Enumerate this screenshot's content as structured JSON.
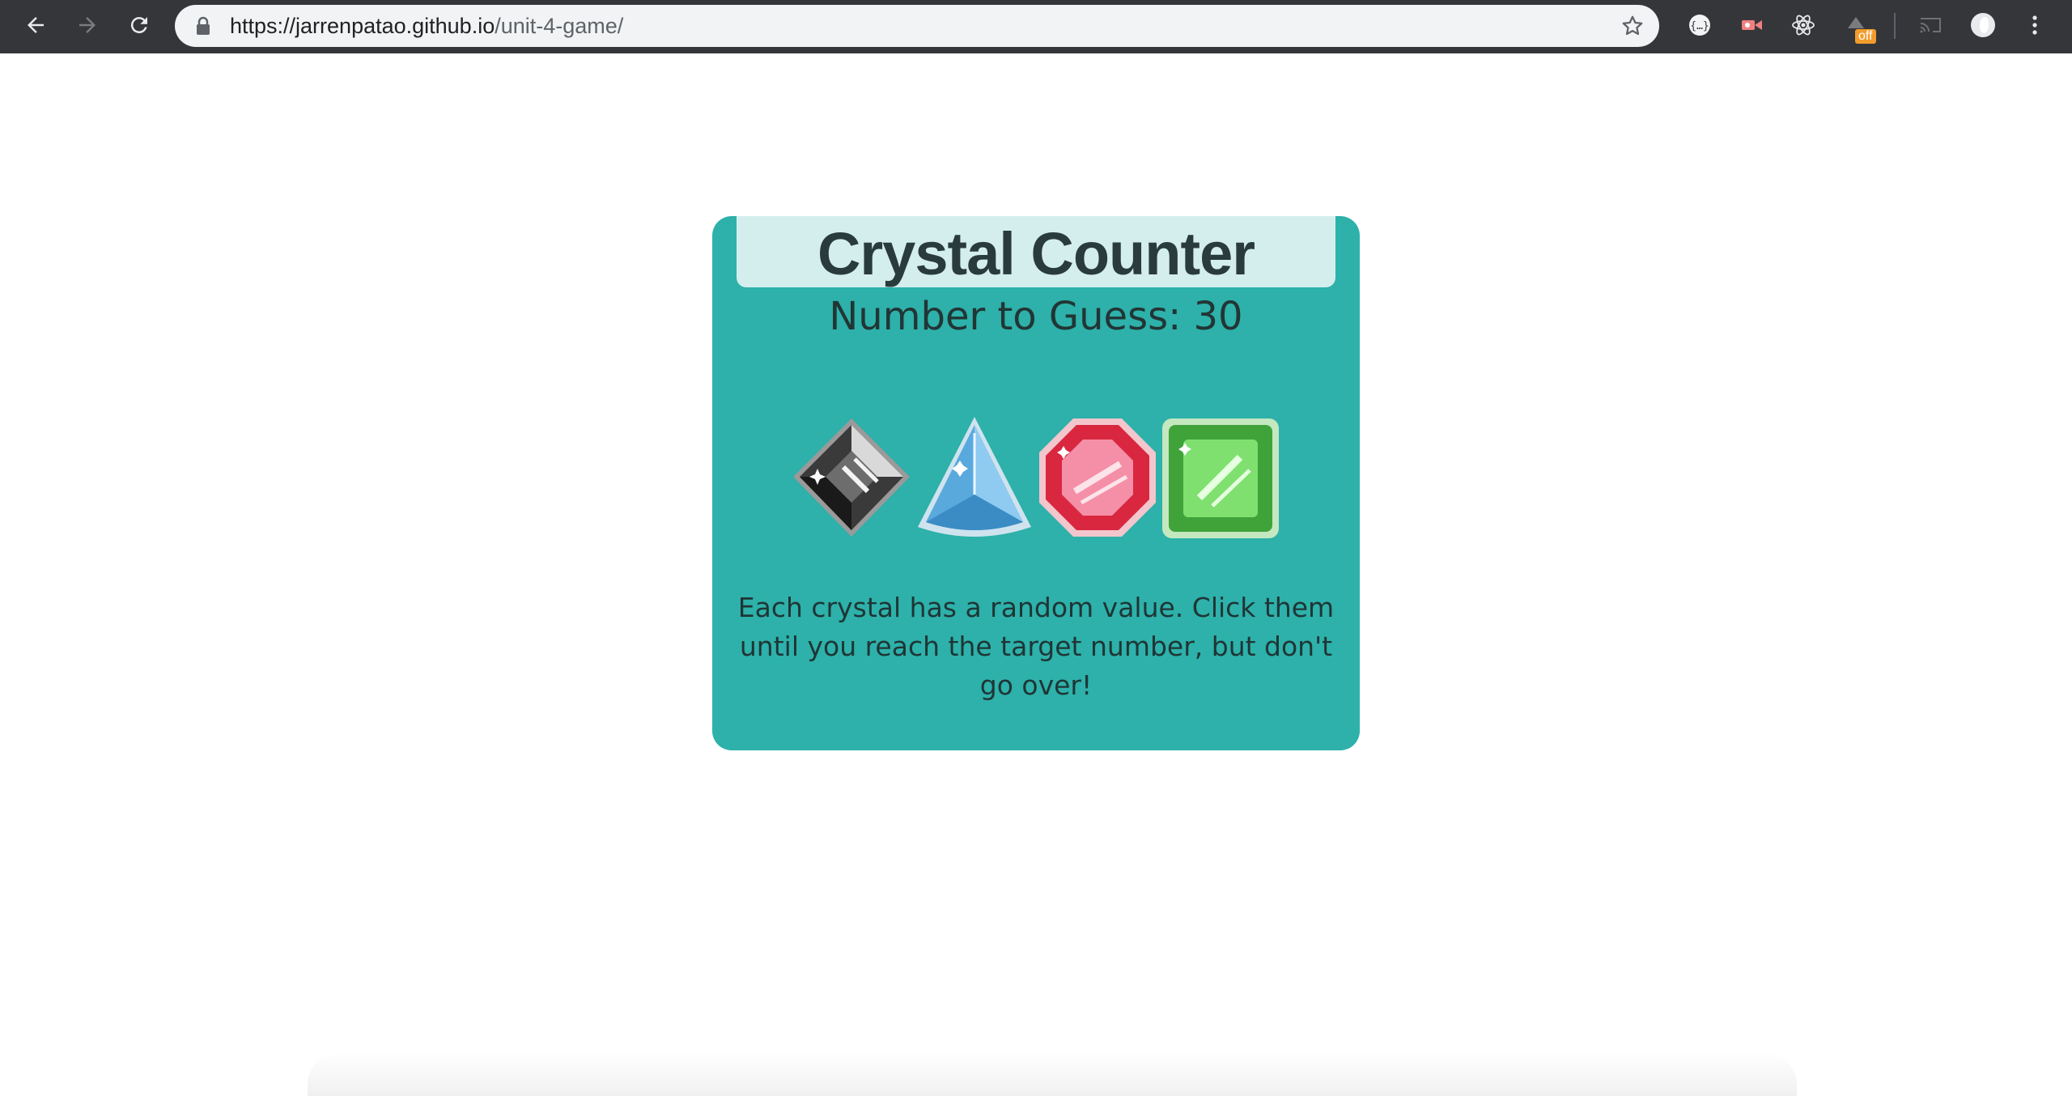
{
  "browser": {
    "url_host": "https://jarrenpatao.github.io",
    "url_path": "/unit-4-game/",
    "nav_icons": [
      "back-arrow-icon",
      "forward-arrow-icon",
      "reload-icon"
    ],
    "extensions": [
      "json-viewer-icon",
      "video-recorder-icon",
      "react-devtools-icon",
      "extension-off-icon",
      "cast-icon",
      "profile-avatar-icon",
      "more-menu-icon"
    ],
    "extension_badge": "off",
    "colors": {
      "toolbar": "#35363a",
      "omnibox": "#f1f3f4"
    }
  },
  "game": {
    "title": "Crystal Counter",
    "target_label": "Number to Guess: 30",
    "crystals": [
      {
        "name": "black-crystal",
        "color": "#2b2b2b"
      },
      {
        "name": "blue-crystal",
        "color": "#6ab7e8"
      },
      {
        "name": "red-crystal",
        "color": "#e0364c"
      },
      {
        "name": "green-crystal",
        "color": "#5fd34f"
      }
    ],
    "instructions": "Each crystal has a random value. Click them until you reach the target number, but don't go over!",
    "colors": {
      "card": "#2db1aa",
      "title_box": "#d3eeed",
      "text": "#223535"
    }
  }
}
